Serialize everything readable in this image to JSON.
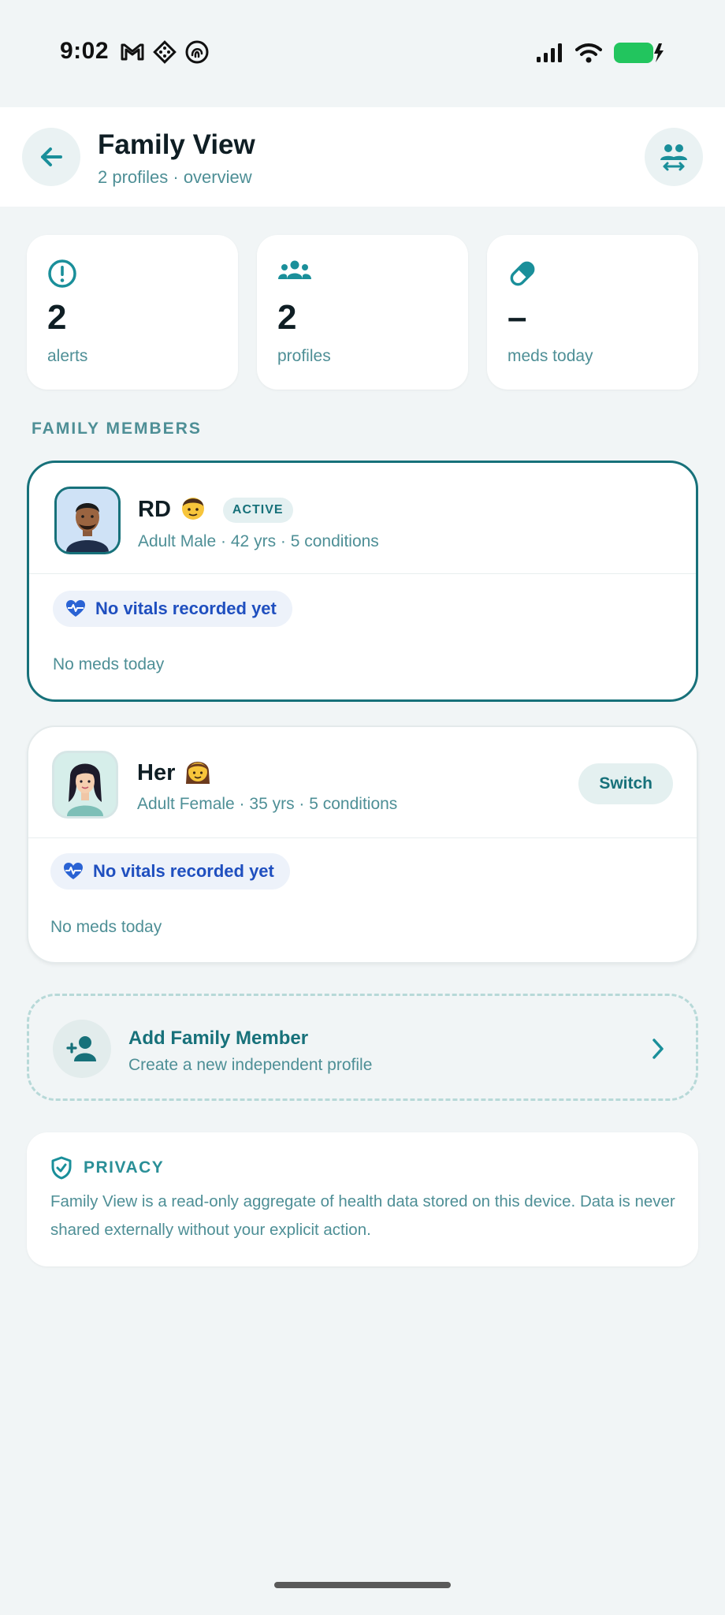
{
  "status_bar": {
    "time": "9:02"
  },
  "header": {
    "title": "Family View",
    "subtitle": "2 profiles · overview"
  },
  "stats": [
    {
      "icon": "alert-circle-icon",
      "value": "2",
      "label": "alerts"
    },
    {
      "icon": "people-group-icon",
      "value": "2",
      "label": "profiles"
    },
    {
      "icon": "pill-icon",
      "value": "–",
      "label": "meds today"
    }
  ],
  "section_label": "FAMILY MEMBERS",
  "members": [
    {
      "name": "RD",
      "emoji": "👨",
      "badge": "ACTIVE",
      "meta": "Adult Male · 42 yrs · 5 conditions",
      "vitals": "No vitals recorded yet",
      "meds": "No meds today"
    },
    {
      "name": "Her",
      "emoji": "👩",
      "action": "Switch",
      "meta": "Adult Female · 35 yrs · 5 conditions",
      "vitals": "No vitals recorded yet",
      "meds": "No meds today"
    }
  ],
  "add_member": {
    "title": "Add Family Member",
    "subtitle": "Create a new independent profile"
  },
  "privacy": {
    "title": "PRIVACY",
    "text": "Family View is a read-only aggregate of health data stored on this device. Data is never shared externally without your explicit action."
  },
  "colors": {
    "accent": "#17717a",
    "muted_text": "#4e8f96",
    "vitals_blue": "#1f4fbf",
    "background": "#f1f5f6"
  }
}
